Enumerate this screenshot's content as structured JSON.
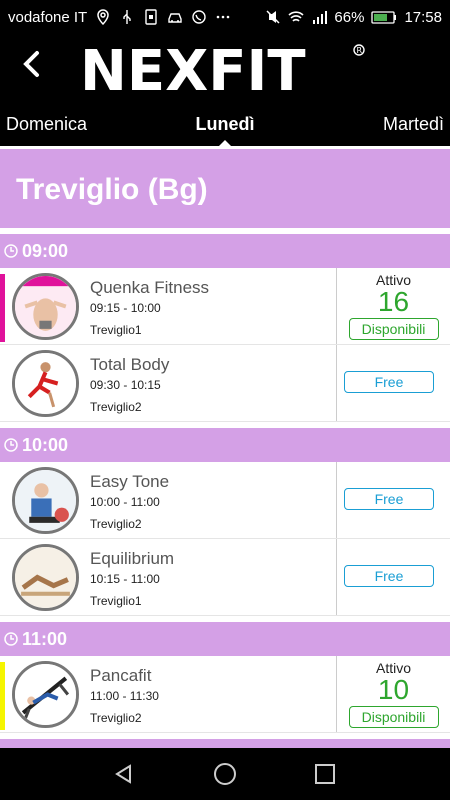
{
  "status_bar": {
    "carrier": "vodafone IT",
    "battery": "66%",
    "time": "17:58",
    "icons": [
      "location-icon",
      "usb-icon",
      "sim-icon",
      "car-icon",
      "whatsapp-icon",
      "more-icon",
      "mute-icon",
      "wifi-icon",
      "signal-icon",
      "battery-icon"
    ]
  },
  "header": {
    "logo_text": "NEXFIT",
    "back_icon": "chevron-left-icon"
  },
  "day_tabs": {
    "prev": "Domenica",
    "current": "Lunedì",
    "next": "Martedì"
  },
  "location": "Treviglio (Bg)",
  "colors": {
    "header_bg": "#d4a0e6",
    "available": "#2ea62e",
    "free": "#1a9ed4",
    "accent_magenta": "#e0129b",
    "accent_yellow": "#f5f500"
  },
  "sections": [
    {
      "time": "09:00",
      "classes": [
        {
          "name": "Quenka Fitness",
          "time": "09:15 - 10:00",
          "location": "Treviglio1",
          "status": "Attivo",
          "count": "16",
          "button": "Disponibili",
          "accent": "magenta"
        },
        {
          "name": "Total Body",
          "time": "09:30 - 10:15",
          "location": "Treviglio2",
          "button": "Free"
        }
      ]
    },
    {
      "time": "10:00",
      "classes": [
        {
          "name": "Easy Tone",
          "time": "10:00 - 11:00",
          "location": "Treviglio2",
          "button": "Free"
        },
        {
          "name": "Equilibrium",
          "time": "10:15 - 11:00",
          "location": "Treviglio1",
          "button": "Free"
        }
      ]
    },
    {
      "time": "11:00",
      "classes": [
        {
          "name": "Pancafit",
          "time": "11:00 - 11:30",
          "location": "Treviglio2",
          "status": "Attivo",
          "count": "10",
          "button": "Disponibili",
          "accent": "yellow"
        }
      ]
    }
  ],
  "nav": {
    "back": "back-icon",
    "home": "home-icon",
    "recents": "recents-icon"
  }
}
